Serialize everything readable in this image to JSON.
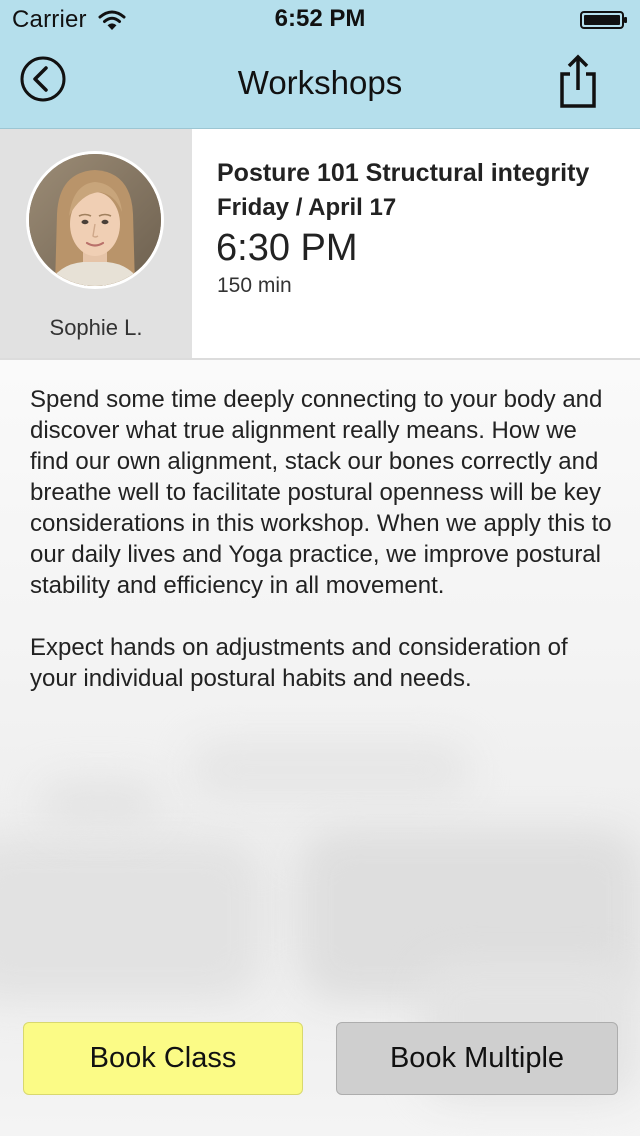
{
  "status_bar": {
    "carrier": "Carrier",
    "time": "6:52 PM",
    "icons": [
      "wifi-icon",
      "battery-icon"
    ]
  },
  "nav": {
    "title": "Workshops",
    "back_icon": "circle-chevron-left-icon",
    "share_icon": "share-icon"
  },
  "instructor": {
    "name": "Sophie L.",
    "avatar": "instructor-photo"
  },
  "session": {
    "title": "Posture 101 Structural integrity",
    "date": "Friday / April 17",
    "time": "6:30 PM",
    "duration": "150 min"
  },
  "description": {
    "paragraphs": [
      "Spend some time deeply connecting to your body and discover what true alignment really means. How we find our own alignment, stack our bones correctly and breathe well to facilitate postural openness will be key considerations in this workshop. When we apply this to our daily lives and Yoga practice, we improve postural stability and efficiency in all movement.",
      "Expect hands on adjustments and consideration of your individual postural habits and needs."
    ]
  },
  "actions": {
    "book_class": "Book Class",
    "book_multiple": "Book Multiple"
  },
  "colors": {
    "nav_background": "#b5dfec",
    "book_class_background": "#fbfb86",
    "book_multiple_background": "#cfcfcf",
    "instructor_panel": "#e1e1e1"
  }
}
